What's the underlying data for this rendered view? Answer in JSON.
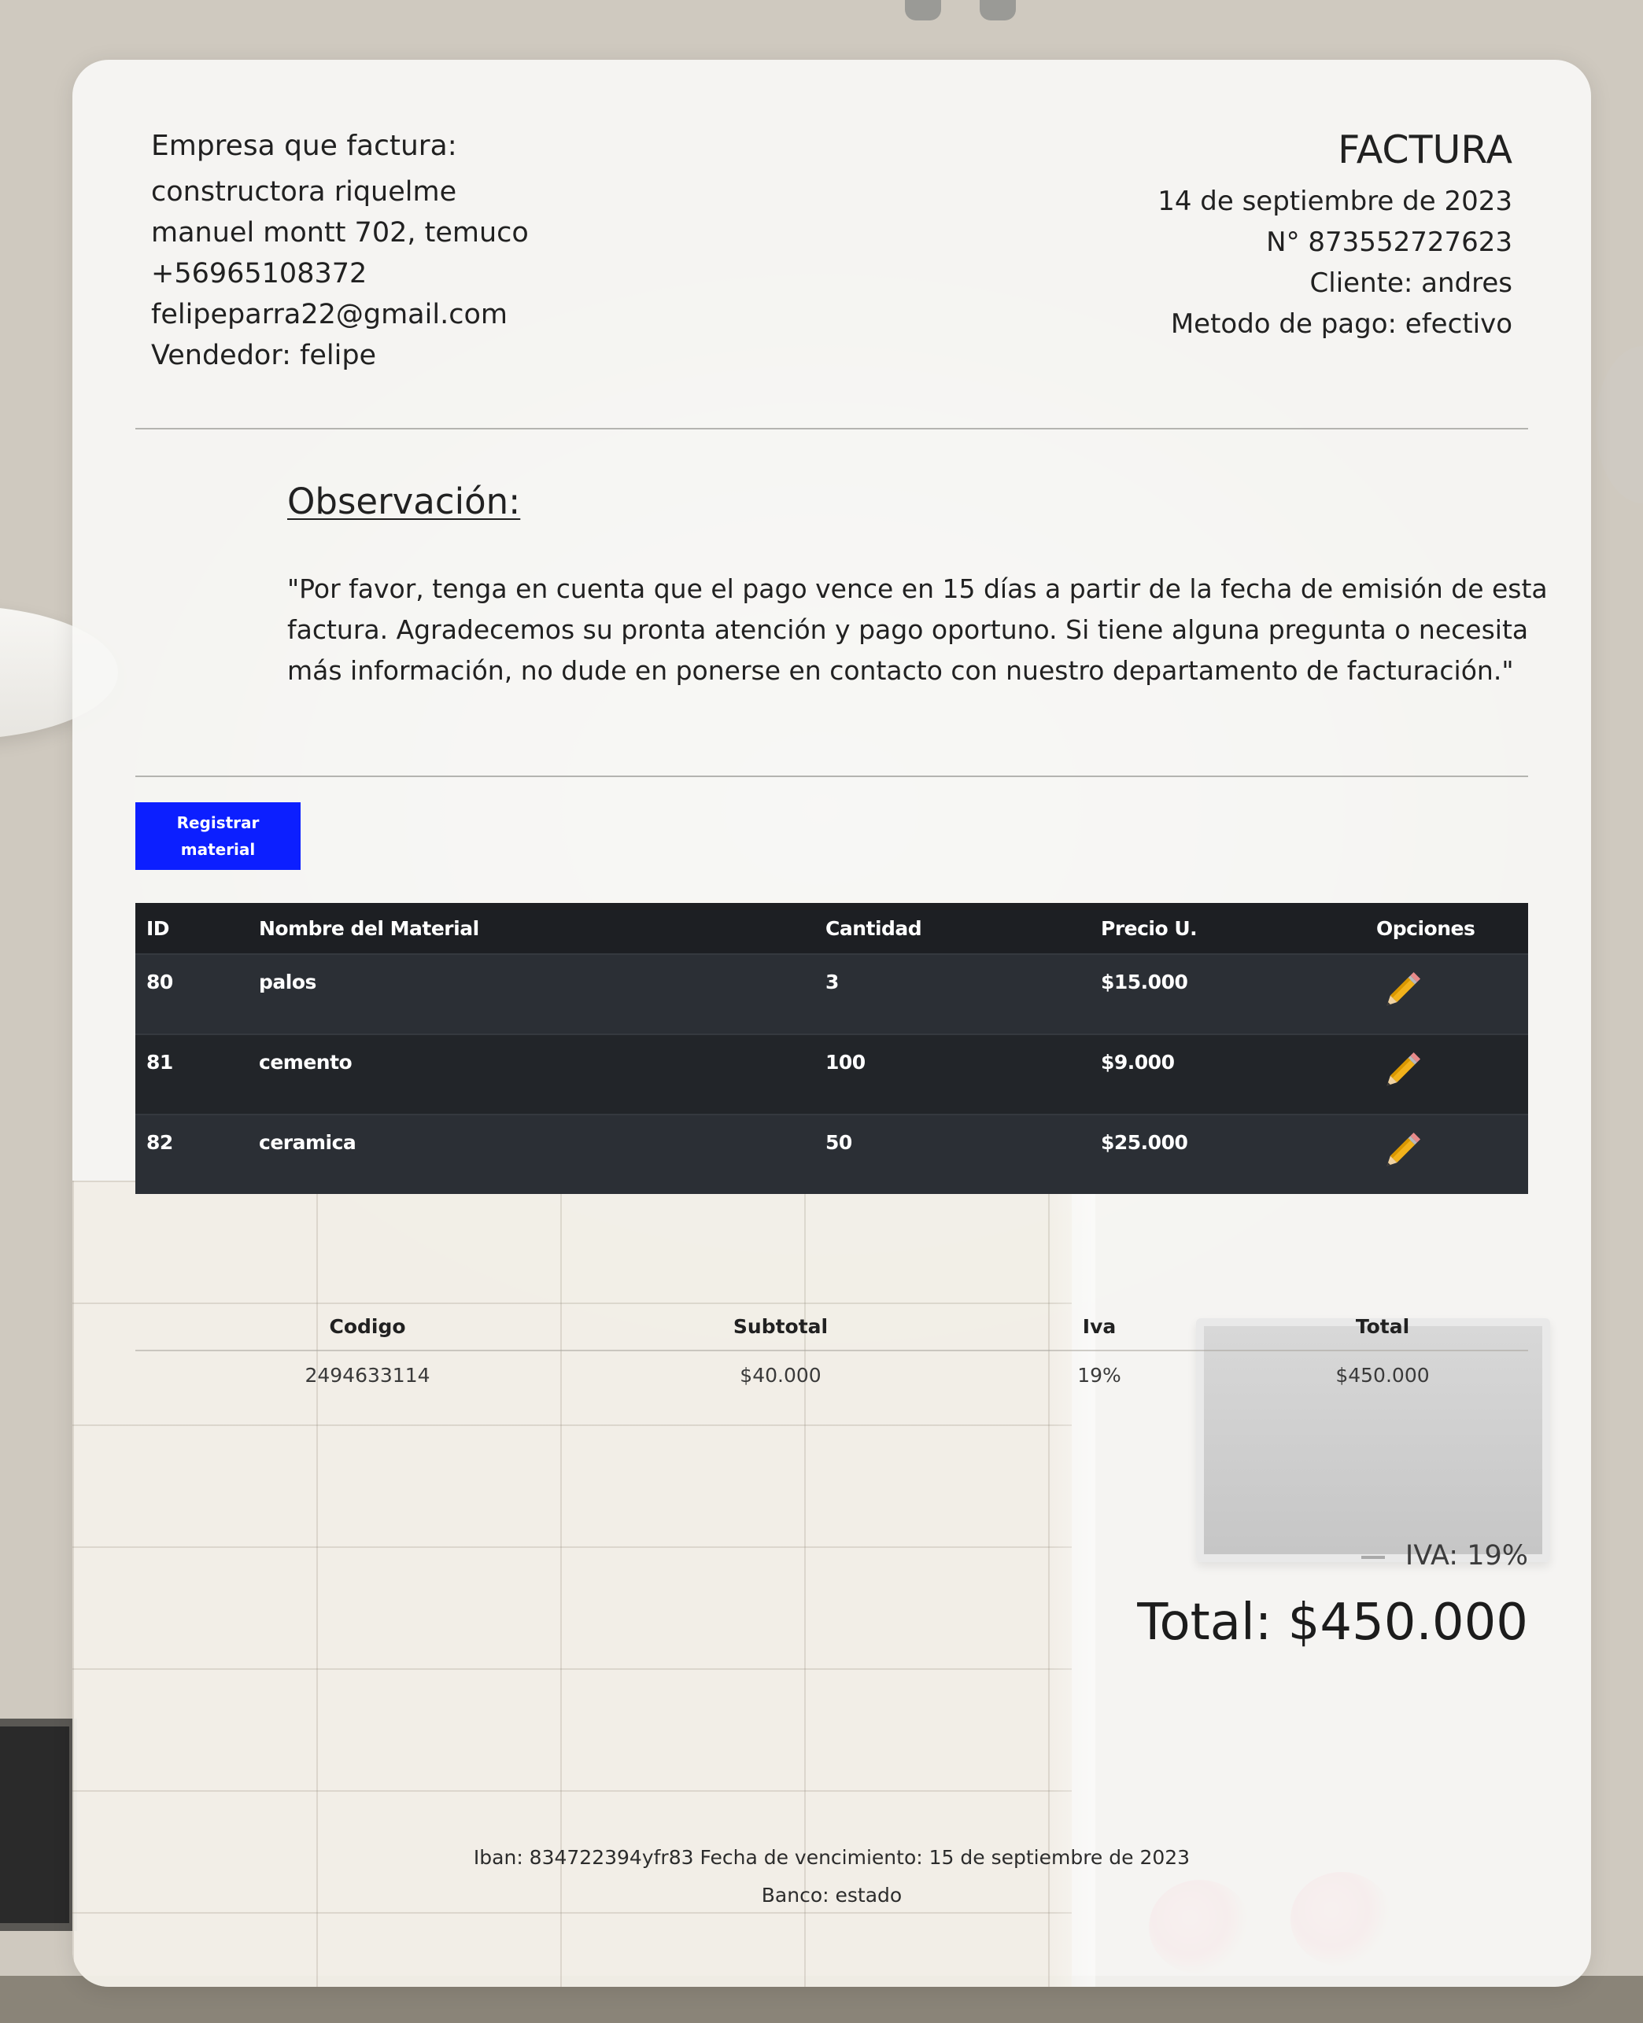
{
  "sender": {
    "label": "Empresa que factura:",
    "company": "constructora riquelme",
    "address": "manuel montt 702, temuco",
    "phone": "+56965108372",
    "email": "felipeparra22@gmail.com",
    "seller": "Vendedor: felipe"
  },
  "invoice_meta": {
    "title": "FACTURA",
    "date": "14 de septiembre de 2023",
    "number": "N° 873552727623",
    "client": "Cliente: andres",
    "payment": "Metodo de pago: efectivo"
  },
  "observation": {
    "title": "Observación:",
    "text": "\"Por favor, tenga en cuenta que el pago vence en 15 días a partir de la fecha de emisión de esta factura. Agradecemos su pronta atención y pago oportuno. Si tiene alguna pregunta o necesita más información, no dude en ponerse en contacto con nuestro departamento de facturación.\""
  },
  "add_button": {
    "label": "Registrar material"
  },
  "materials_table": {
    "headers": [
      "ID",
      "Nombre del Material",
      "Cantidad",
      "Precio U.",
      "Opciones"
    ],
    "rows": [
      {
        "id": "80",
        "name": "palos",
        "qty": "3",
        "price": "$15.000"
      },
      {
        "id": "81",
        "name": "cemento",
        "qty": "100",
        "price": "$9.000"
      },
      {
        "id": "82",
        "name": "ceramica",
        "qty": "50",
        "price": "$25.000"
      }
    ],
    "edit_icon": "pencil-icon"
  },
  "totals_table": {
    "headers": [
      "Codigo",
      "Subtotal",
      "Iva",
      "Total"
    ],
    "row": {
      "code": "2494633114",
      "subtotal": "$40.000",
      "iva": "19%",
      "total": "$450.000"
    }
  },
  "summary": {
    "iva": "IVA: 19%",
    "total": "Total: $450.000"
  },
  "footer": {
    "line1": "Iban: 834722394yfr83 Fecha de vencimiento: 15 de septiembre de 2023",
    "line2": "Banco: estado"
  },
  "colors": {
    "button_blue": "#0c1fff",
    "table_dark": "#212429",
    "card_bg": "#f8f7f5"
  }
}
